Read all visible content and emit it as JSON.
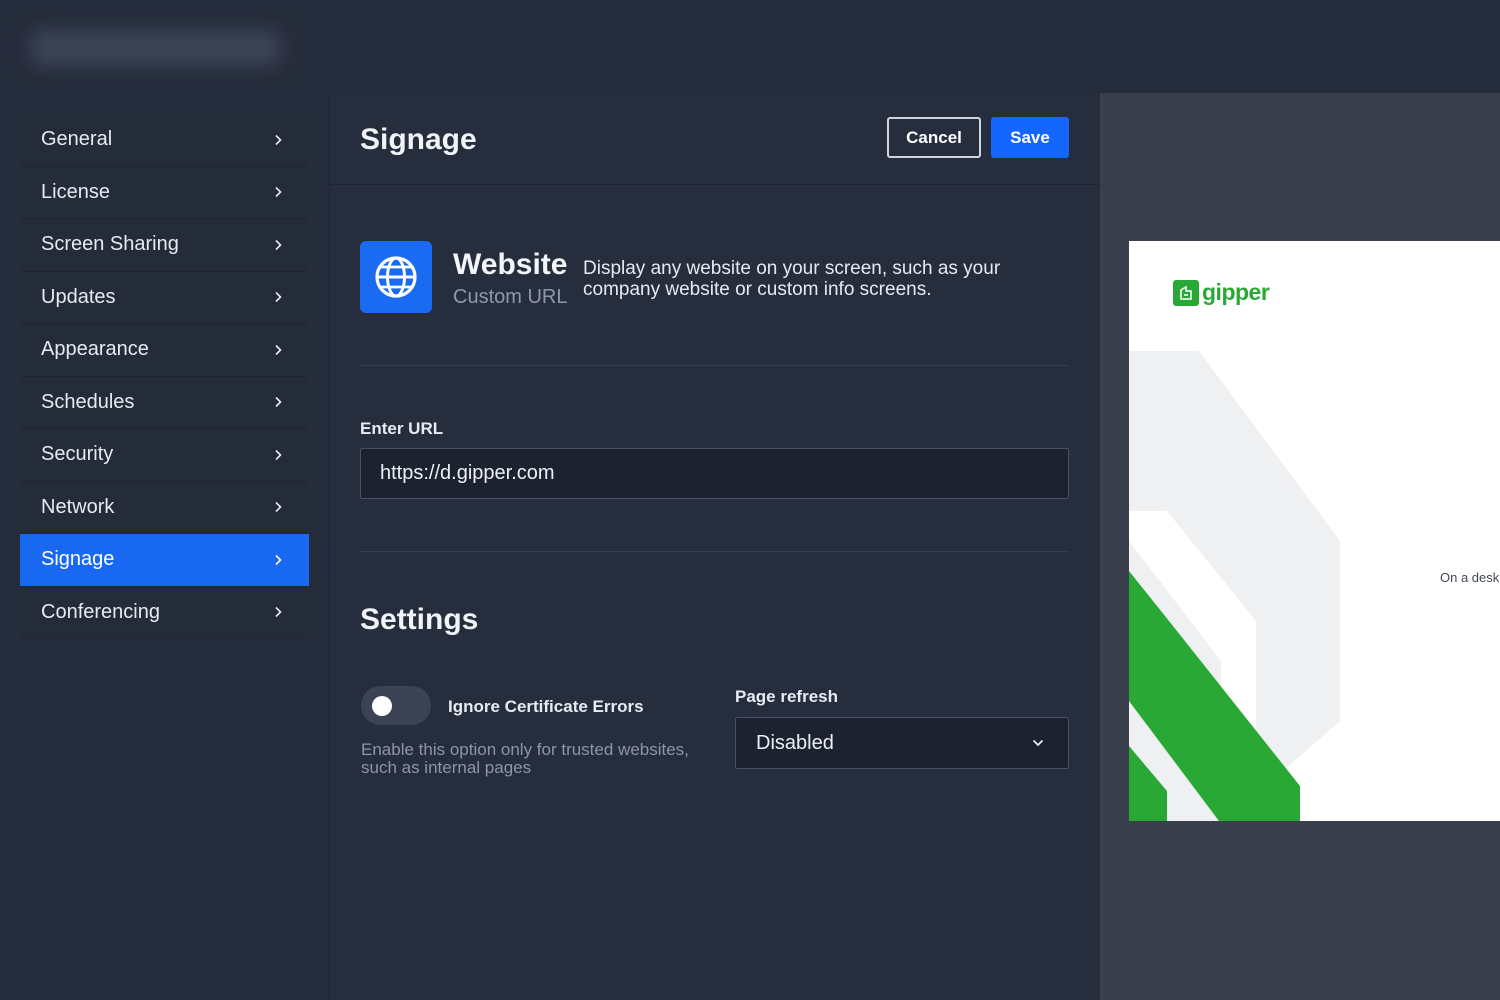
{
  "header": {
    "app_title_blurred": true
  },
  "sidebar": {
    "items": [
      {
        "label": "General",
        "active": false
      },
      {
        "label": "License",
        "active": false
      },
      {
        "label": "Screen Sharing",
        "active": false
      },
      {
        "label": "Updates",
        "active": false
      },
      {
        "label": "Appearance",
        "active": false
      },
      {
        "label": "Schedules",
        "active": false
      },
      {
        "label": "Security",
        "active": false
      },
      {
        "label": "Network",
        "active": false
      },
      {
        "label": "Signage",
        "active": true
      },
      {
        "label": "Conferencing",
        "active": false
      }
    ]
  },
  "main": {
    "title": "Signage",
    "cancel_label": "Cancel",
    "save_label": "Save",
    "website": {
      "icon": "globe-icon",
      "title": "Website",
      "subtitle": "Custom URL",
      "description": "Display any website on your screen, such as your company website or custom info screens."
    },
    "url": {
      "label": "Enter URL",
      "value": "https://d.gipper.com",
      "placeholder": ""
    },
    "settings": {
      "title": "Settings",
      "ignore_cert": {
        "label": "Ignore Certificate Errors",
        "enabled": false,
        "help": "Enable this option only for trusted websites, such as internal pages"
      },
      "page_refresh": {
        "label": "Page refresh",
        "selected": "Disabled"
      }
    }
  },
  "preview": {
    "logo_text": "gipper",
    "caption": "On a desk"
  },
  "colors": {
    "accent": "#1466ff",
    "active_nav": "#1868f2",
    "gipper_green": "#2aa836",
    "background": "#272e3e"
  }
}
